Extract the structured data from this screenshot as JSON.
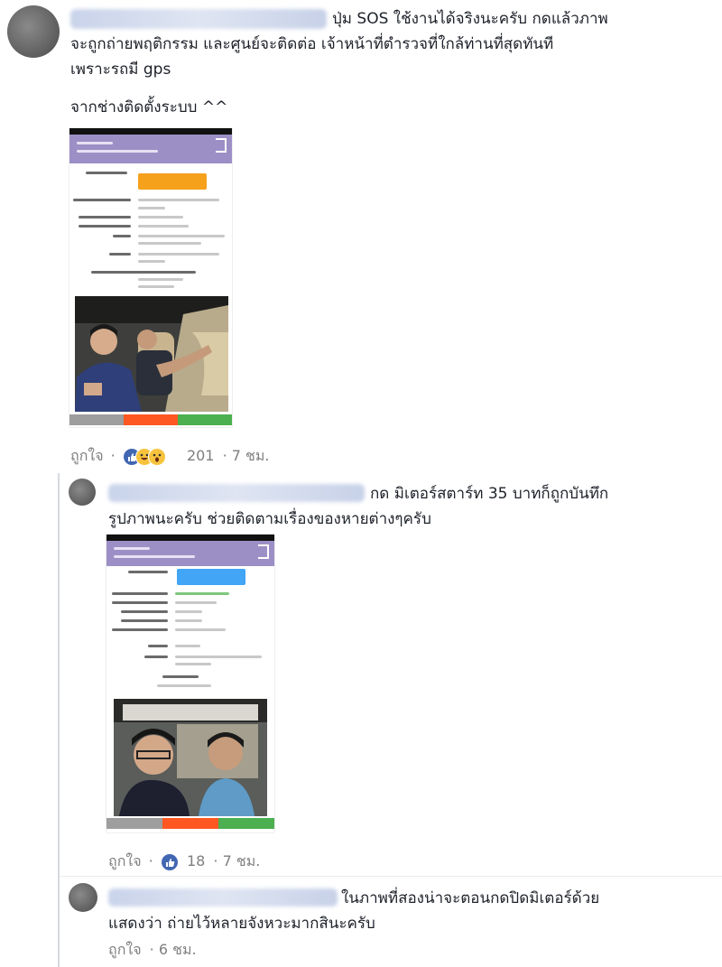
{
  "comment1": {
    "text_line1": "ปุ่ม SOS ใช้งานได้จริงนะครับ กดแล้วภาพ",
    "text_line2": "จะถูกถ่ายพฤติกรรม และศูนย์จะติดต่อ เจ้าหน้าที่ตำรวจที่ใกล้ท่านที่สุดทันที",
    "text_line3": "เพราะรถมี gps",
    "text_line4": "จากช่างติดตั้งระบบ ^^",
    "like_label": "ถูกใจ",
    "dot": "·",
    "reaction_count": "201",
    "time": "· 7 ชม."
  },
  "reply1": {
    "text_line1": "กด มิเตอร์สตาร์ท 35 บาทก็ถูกบันทึก",
    "text_line2": "รูปภาพนะครับ ช่วยติดตามเรื่องของหายต่างๆครับ",
    "like_label": "ถูกใจ",
    "dot": "·",
    "reaction_count": "18",
    "time": "· 7 ชม."
  },
  "reply2": {
    "text_line1": "ในภาพที่สองน่าจะตอนกดปิดมิเตอร์ด้วย",
    "text_line2": "แสดงว่า ถ่ายไว้หลายจังหวะมากสินะครับ",
    "like_label": "ถูกใจ",
    "time": "· 6 ชม."
  },
  "colors": {
    "phone_header": "#9c8fc6",
    "orange_button": "#f5a11c",
    "blue_button": "#42a5f5",
    "nav_gray": "#9e9e9e",
    "nav_orange": "#ff5722",
    "nav_green": "#4caf50",
    "like_blue": "#4267b2"
  },
  "icons": {
    "like": "like-reaction-icon",
    "haha": "haha-reaction-icon",
    "wow": "wow-reaction-icon"
  }
}
